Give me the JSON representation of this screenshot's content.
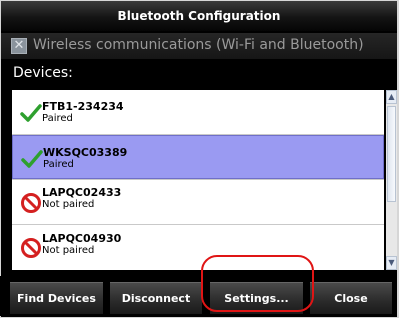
{
  "window": {
    "title": "Bluetooth Configuration"
  },
  "wireless": {
    "label": "Wireless communications (Wi-Fi and Bluetooth)",
    "checked": true
  },
  "devices_label": "Devices:",
  "devices": [
    {
      "name": "FTB1-234234",
      "status": "Paired",
      "icon": "checkmark-icon"
    },
    {
      "name": "WKSQC03389",
      "status": "Paired",
      "icon": "checkmark-icon",
      "selected": true
    },
    {
      "name": "LAPQC02433",
      "status": "Not paired",
      "icon": "no-entry-icon"
    },
    {
      "name": "LAPQC04930",
      "status": "Not paired",
      "icon": "no-entry-icon"
    }
  ],
  "buttons": {
    "find_devices": "Find Devices",
    "disconnect": "Disconnect",
    "settings": "Settings...",
    "close": "Close"
  },
  "colors": {
    "selection": "#9a9af2",
    "highlight_circle": "#e01515",
    "paired_check": "#2ea02e",
    "not_paired": "#d42020"
  }
}
